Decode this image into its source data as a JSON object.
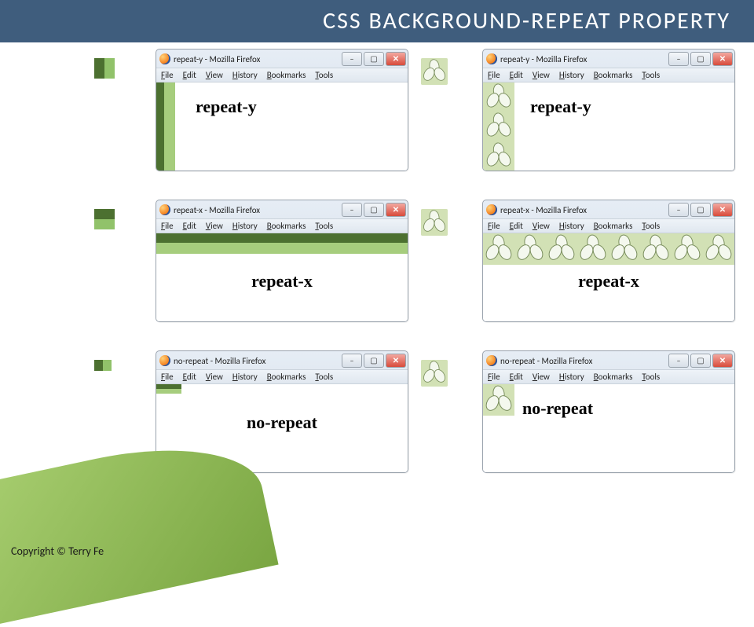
{
  "title": "CSS BACKGROUND-REPEAT PROPERTY",
  "menu": {
    "file": "File",
    "edit": "Edit",
    "view": "View",
    "history": "History",
    "bookmarks": "Bookmarks",
    "tools": "Tools"
  },
  "windows": {
    "repeat_y_left": {
      "title": "repeat-y - Mozilla Firefox",
      "label": "repeat-y"
    },
    "repeat_y_right": {
      "title": "repeat-y - Mozilla Firefox",
      "label": "repeat-y"
    },
    "repeat_x_left": {
      "title": "repeat-x - Mozilla Firefox",
      "label": "repeat-x"
    },
    "repeat_x_right": {
      "title": "repeat-x - Mozilla Firefox",
      "label": "repeat-x"
    },
    "no_repeat_left": {
      "title": "no-repeat - Mozilla Firefox",
      "label": "no-repeat"
    },
    "no_repeat_right": {
      "title": "no-repeat - Mozilla Firefox",
      "label": "no-repeat"
    }
  },
  "copyright": "Copyright © Terry Fe"
}
